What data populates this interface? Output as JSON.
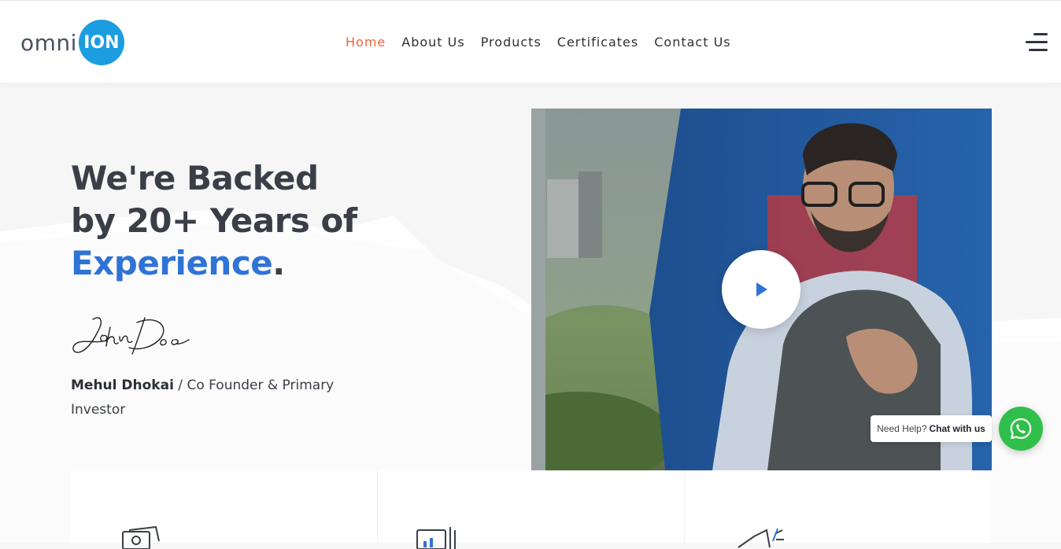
{
  "brand": {
    "logo_left": "omni",
    "logo_right": "ION",
    "accent": "#1b9ddf"
  },
  "nav": {
    "items": [
      {
        "label": "Home",
        "active": true
      },
      {
        "label": "About Us",
        "active": false
      },
      {
        "label": "Products",
        "active": false
      },
      {
        "label": "Certificates",
        "active": false
      },
      {
        "label": "Contact Us",
        "active": false
      }
    ],
    "active_color": "#f0623a",
    "menu_icon": "hamburger-icon"
  },
  "hero": {
    "headline_line1": "We're Backed",
    "headline_line2": "by 20+ Years of",
    "headline_accent": "Experience",
    "headline_end": ".",
    "accent_color": "#2f73d6",
    "signature_text": "John Doe",
    "founder_name": "Mehul Dhokai",
    "founder_separator": " / ",
    "founder_role": "Co Founder & Primary Investor"
  },
  "video": {
    "play_icon": "play-icon"
  },
  "features": {
    "icons": [
      "money-icon",
      "chart-document-icon",
      "megaphone-icon"
    ]
  },
  "whatsapp": {
    "prompt": "Need Help?",
    "cta": "Chat with us",
    "icon": "whatsapp-icon",
    "color": "#2fbf4a"
  }
}
